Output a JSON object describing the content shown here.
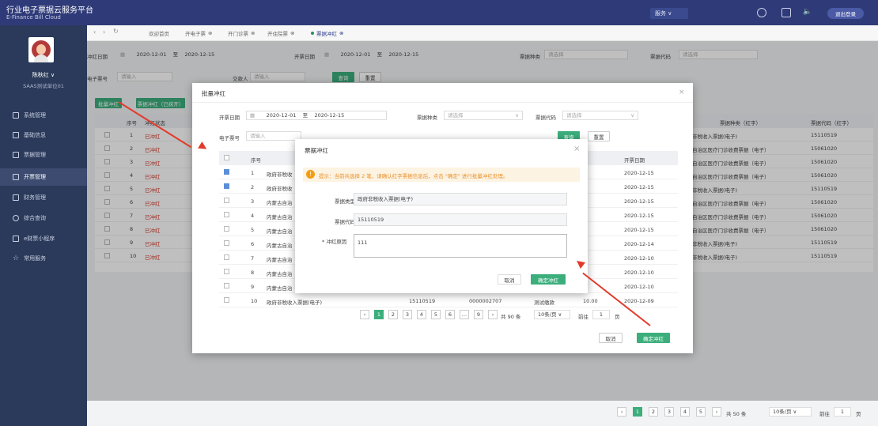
{
  "app": {
    "title": "行业电子票据云服务平台",
    "subtitle": "E-Finance Bill Cloud"
  },
  "topbar": {
    "service_label": "服务",
    "logout_label": "退出登录"
  },
  "user": {
    "name": "陈秋红 ∨",
    "org": "SAAS测试单位01"
  },
  "sidebar": {
    "items": [
      {
        "label": "系统管理"
      },
      {
        "label": "基础信息"
      },
      {
        "label": "票据管理"
      },
      {
        "label": "开票管理"
      },
      {
        "label": "财务管理"
      },
      {
        "label": "综合查询"
      },
      {
        "label": "e财票小程序"
      },
      {
        "label": "常用服务"
      }
    ]
  },
  "tabs": [
    {
      "label": "欢迎首页"
    },
    {
      "label": "开电子票"
    },
    {
      "label": "开门诊票"
    },
    {
      "label": "开住院票"
    },
    {
      "label": "票据冲红"
    }
  ],
  "filters": {
    "date_label": "冲红日期",
    "date_from": "2020-12-01",
    "to": "至",
    "date_to": "2020-12-15",
    "issue_label": "开票日期",
    "issue_from": "2020-12-01",
    "issue_to": "2020-12-15",
    "type_label": "票据种类",
    "type_placeholder": "请选择",
    "code_label": "票据代码",
    "code_placeholder": "请选择",
    "number_label": "电子票号",
    "number_placeholder": "请输入",
    "payer_label": "交款人",
    "payer_placeholder": "请输入",
    "query": "查询",
    "reset": "重置"
  },
  "toolbar": {
    "batch": "批量冲红",
    "batch_done": "票据冲红（已抹开）"
  },
  "bg_table": {
    "headers": [
      "序号",
      "冲红状态",
      "票据种类（红字）",
      "票据代码（红字）"
    ],
    "rows": [
      {
        "no": "1",
        "status": "已冲红",
        "kind": "非税收入票据(电子)",
        "code": "15110519"
      },
      {
        "no": "2",
        "status": "已冲红",
        "kind": "自治区医疗门诊收费票据（电子）",
        "code": "15061020"
      },
      {
        "no": "3",
        "status": "已冲红",
        "kind": "自治区医疗门诊收费票据（电子）",
        "code": "15061020"
      },
      {
        "no": "4",
        "status": "已冲红",
        "kind": "自治区医疗门诊收费票据（电子）",
        "code": "15061020"
      },
      {
        "no": "5",
        "status": "已冲红",
        "kind": "非税收入票据(电子)",
        "code": "15110519"
      },
      {
        "no": "6",
        "status": "已冲红",
        "kind": "自治区医疗门诊收费票据（电子）",
        "code": "15061020"
      },
      {
        "no": "7",
        "status": "已冲红",
        "kind": "自治区医疗门诊收费票据（电子）",
        "code": "15061020"
      },
      {
        "no": "8",
        "status": "已冲红",
        "kind": "自治区医疗门诊收费票据（电子）",
        "code": "15061020"
      },
      {
        "no": "9",
        "status": "已冲红",
        "kind": "非税收入票据(电子)",
        "code": "15110519"
      },
      {
        "no": "10",
        "status": "已冲红",
        "kind": "非税收入票据(电子)",
        "code": "15110519"
      }
    ]
  },
  "bg_pagination": {
    "pages": [
      "1",
      "2",
      "3",
      "4",
      "5"
    ],
    "total": "共 50 条",
    "per_page": "10条/页",
    "goto": "前往",
    "goto_page": "1",
    "page_unit": "页"
  },
  "modal1": {
    "title": "批量冲红",
    "issue_label": "开票日期",
    "date_from": "2020-12-01",
    "to": "至",
    "date_to": "2020-12-15",
    "type_label": "票据种类",
    "type_placeholder": "请选择",
    "code_label": "票据代码",
    "code_placeholder": "请选择",
    "number_label": "电子票号",
    "number_placeholder": "请输入",
    "query": "查询",
    "reset": "重置",
    "col_no": "序号",
    "col_date": "开票日期",
    "rows": [
      {
        "no": "1",
        "name": "政府非税收",
        "date": "2020-12-15",
        "checked": true
      },
      {
        "no": "2",
        "name": "政府非税收",
        "date": "2020-12-15",
        "checked": true
      },
      {
        "no": "3",
        "name": "内蒙古自治",
        "date": "2020-12-15",
        "checked": false
      },
      {
        "no": "4",
        "name": "内蒙古自治",
        "date": "2020-12-15",
        "checked": false
      },
      {
        "no": "5",
        "name": "内蒙古自治",
        "date": "2020-12-15",
        "checked": false
      },
      {
        "no": "6",
        "name": "内蒙古自治",
        "date": "2020-12-14",
        "checked": false
      },
      {
        "no": "7",
        "name": "内蒙古自治",
        "date": "2020-12-10",
        "checked": false
      },
      {
        "no": "8",
        "name": "内蒙古自治",
        "date": "2020-12-10",
        "checked": false
      },
      {
        "no": "9",
        "name": "内蒙古自治",
        "date": "2020-12-10",
        "checked": false
      },
      {
        "no": "10",
        "name": "政府非税收入票据(电子)",
        "code": "15110519",
        "num": "0000002707",
        "payer": "测试缴款",
        "amount": "10.00",
        "date": "2020-12-09",
        "checked": false
      }
    ],
    "pages": [
      "1",
      "2",
      "3",
      "4",
      "5",
      "6",
      "…",
      "9"
    ],
    "total": "共 90 条",
    "per_page": "10条/页",
    "goto": "前往",
    "goto_page": "1",
    "page_unit": "页",
    "cancel": "取消",
    "confirm": "确定冲红"
  },
  "modal2": {
    "title": "票据冲红",
    "notice": "提示：当前共选择 2 笔，请确认红字票据信息后，点击 \"确定\" 进行批量冲红处理。",
    "type_label": "票据类型",
    "type_value": "政府非税收入票据(电子)",
    "code_label": "票据代码",
    "code_value": "15110519",
    "reason_label": "* 冲红原因",
    "reason_value": "111",
    "cancel": "取消",
    "confirm": "确定冲红"
  },
  "colors": {
    "nav": "#2f3b78",
    "sidebar": "#2b3a5a",
    "accent": "#3cae7c",
    "warn": "#f39c12",
    "red": "#d4392b"
  }
}
